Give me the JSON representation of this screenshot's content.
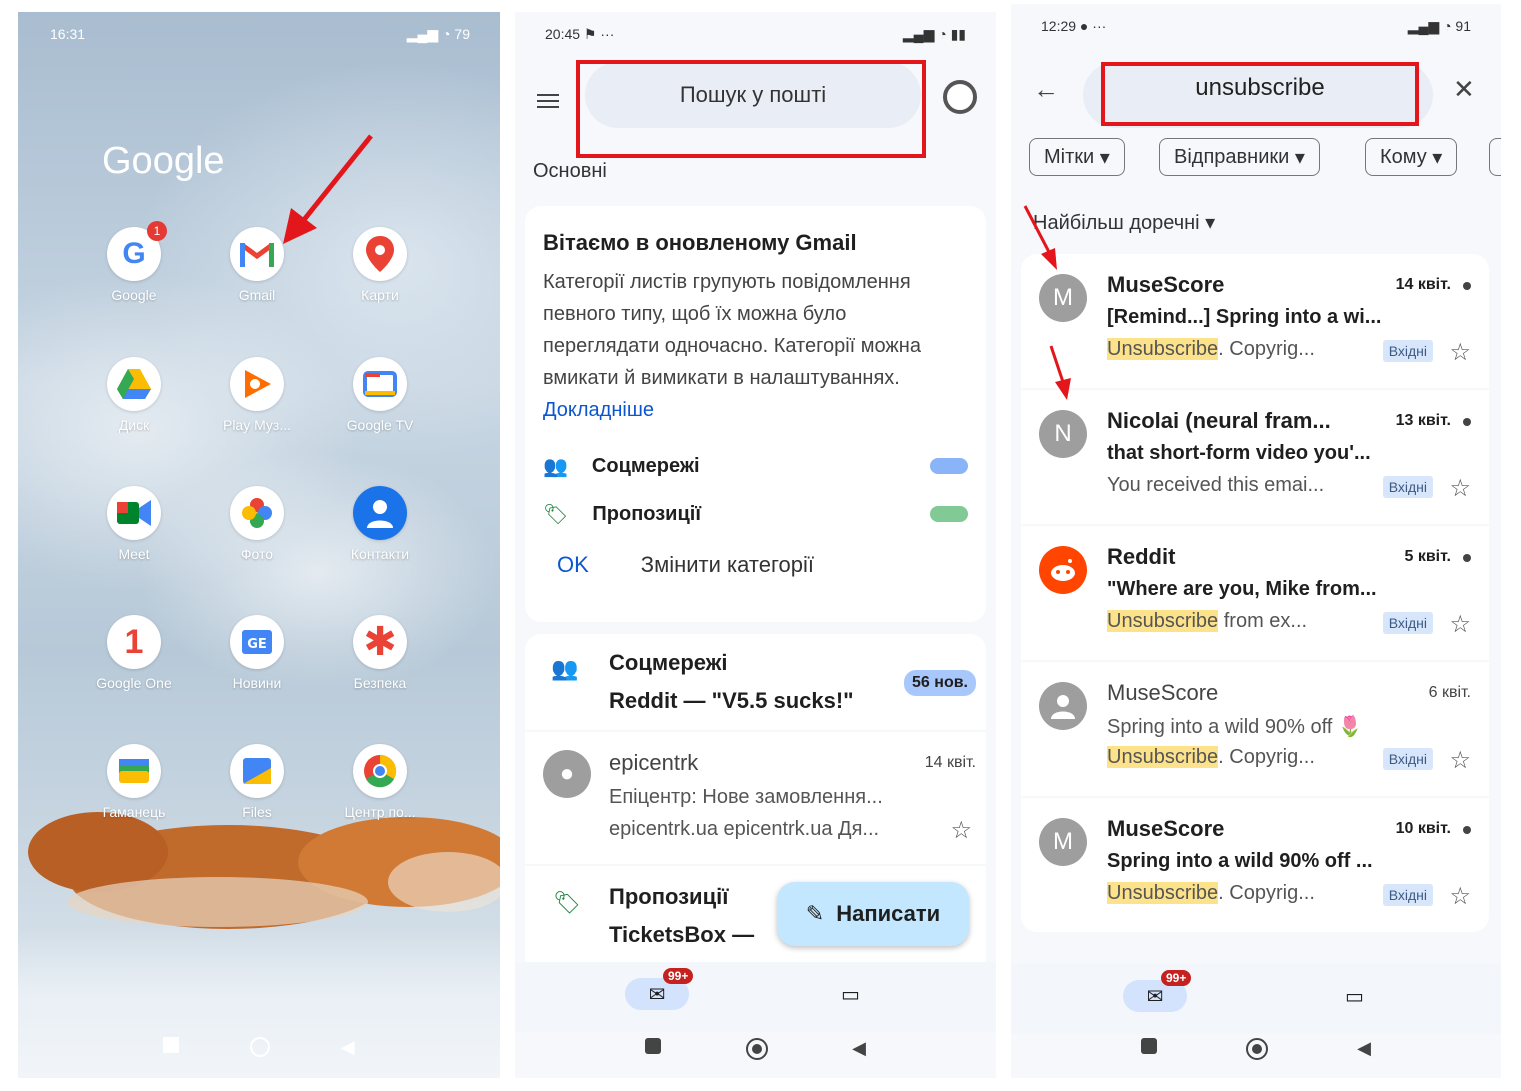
{
  "phone1": {
    "time": "16:31",
    "battery": "79",
    "folder_title": "Google",
    "apps": [
      {
        "label": "Google",
        "badge": "1"
      },
      {
        "label": "Gmail"
      },
      {
        "label": "Карти"
      },
      {
        "label": "Диск"
      },
      {
        "label": "Play Муз..."
      },
      {
        "label": "Google TV"
      },
      {
        "label": "Meet"
      },
      {
        "label": "Фото"
      },
      {
        "label": "Контакти"
      },
      {
        "label": "Google One"
      },
      {
        "label": "Новини"
      },
      {
        "label": "Безпека"
      },
      {
        "label": "Гаманець"
      },
      {
        "label": "Files"
      },
      {
        "label": "Центр по..."
      }
    ]
  },
  "phone2": {
    "time": "20:45",
    "search_placeholder": "Пошук у пошті",
    "section_label": "Основні",
    "welcome": {
      "title": "Вітаємо в оновленому Gmail",
      "text": "Категорії листів групують повідомлення певного типу, щоб їх можна було переглядати одночасно. Категорії можна вмикати й вимикати в налаштуваннях.",
      "link": "Докладніше",
      "categories": [
        {
          "name": "Соцмережі",
          "color": "#8ab4f8"
        },
        {
          "name": "Пропозиції",
          "color": "#81c995"
        }
      ],
      "ok": "OK",
      "change": "Змінити категорії"
    },
    "social_row": {
      "title": "Соцмережі",
      "subtitle": "Reddit — \"V5.5 sucks!\"",
      "badge": "56 нов."
    },
    "mail": {
      "sender": "epicentrk",
      "date": "14 квіт.",
      "subject": "Епіцентр: Нове замовлення...",
      "snippet": "epicentrk.ua epicentrk.ua Дя..."
    },
    "promo_row": {
      "title": "Пропозиції",
      "subtitle": "TicketsBox — "
    },
    "compose": "Написати",
    "mail_badge": "99+"
  },
  "phone3": {
    "time": "12:29",
    "battery": "91",
    "query": "unsubscribe",
    "chips": [
      "Мітки",
      "Відправники",
      "Кому"
    ],
    "sort_label": "Найбільш доречні",
    "inbox_tag": "Вхідні",
    "results": [
      {
        "initial": "M",
        "sender": "MuseScore",
        "date": "14 квіт.",
        "subject": "[Remind...] Spring into a wi...",
        "highlight": "Unsubscribe",
        "snippet": ". Copyrig...",
        "unread": true,
        "avatar_color": "#9e9e9e"
      },
      {
        "initial": "N",
        "sender": "Nicolai (neural fram...",
        "date": "13 квіт.",
        "subject": "that short-form video you'...",
        "highlight": "",
        "snippet": "You received this emai...",
        "unread": true,
        "avatar_color": "#9e9e9e"
      },
      {
        "initial": "",
        "sender": "Reddit",
        "date": "5 квіт.",
        "subject": "\"Where are you, Mike from...",
        "highlight": "Unsubscribe",
        "snippet": " from ex...",
        "unread": true,
        "avatar_color": "#ff4500"
      },
      {
        "initial": "",
        "sender": "MuseScore",
        "date": "6 квіт.",
        "subject": "Spring into a wild 90% off 🌷",
        "highlight": "Unsubscribe",
        "snippet": ". Copyrig...",
        "unread": false,
        "avatar_color": "#9e9e9e"
      },
      {
        "initial": "M",
        "sender": "MuseScore",
        "date": "10 квіт.",
        "subject": "Spring into a wild 90% off ...",
        "highlight": "Unsubscribe",
        "snippet": ". Copyrig...",
        "unread": true,
        "avatar_color": "#9e9e9e"
      }
    ],
    "mail_badge": "99+"
  },
  "colors": {
    "annotation_red": "#e3161c",
    "link_blue": "#0b57d0",
    "highlight_yellow": "#fce28a"
  }
}
